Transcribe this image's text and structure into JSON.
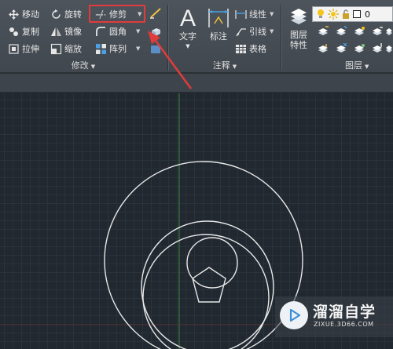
{
  "modify_panel": {
    "title": "修改",
    "move": "移动",
    "rotate": "旋转",
    "trim": "修剪",
    "copy": "复制",
    "mirror": "镜像",
    "fillet": "圆角",
    "stretch": "拉伸",
    "scale": "缩放",
    "array": "阵列"
  },
  "annotation_panel": {
    "title": "注释",
    "text": "文字",
    "dimension": "标注",
    "linear": "线性",
    "leader": "引线",
    "table": "表格"
  },
  "layers_panel": {
    "title": "图层",
    "properties_line1": "图层",
    "properties_line2": "特性",
    "current_layer": "0"
  },
  "dropdown_glyph": "▼",
  "watermark": {
    "title": "溜溜自学",
    "url": "ZIXUE.3D66.COM"
  },
  "colors": {
    "highlight": "#e23b3b",
    "arrow": "#e23b3b",
    "canvas": "#212830",
    "ucs_y_axis": "#3a8a3a",
    "geometry": "#e8e8e8"
  }
}
